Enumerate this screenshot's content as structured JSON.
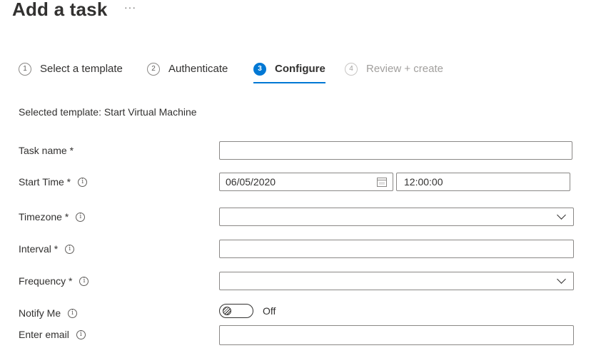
{
  "header": {
    "title": "Add a task",
    "more_label": "···"
  },
  "steps": [
    {
      "number": "1",
      "label": "Select a template",
      "state": "complete"
    },
    {
      "number": "2",
      "label": "Authenticate",
      "state": "complete"
    },
    {
      "number": "3",
      "label": "Configure",
      "state": "active"
    },
    {
      "number": "4",
      "label": "Review + create",
      "state": "disabled"
    }
  ],
  "selected_template": "Selected template: Start Virtual Machine",
  "form": {
    "task_name": {
      "label": "Task name *",
      "value": ""
    },
    "start_time": {
      "label": "Start Time *",
      "date": "06/05/2020",
      "time": "12:00:00"
    },
    "timezone": {
      "label": "Timezone *",
      "value": ""
    },
    "interval": {
      "label": "Interval *",
      "value": ""
    },
    "frequency": {
      "label": "Frequency *",
      "value": ""
    },
    "notify_me": {
      "label": "Notify Me",
      "state": "Off"
    },
    "email": {
      "label": "Enter email",
      "value": ""
    }
  },
  "icons": {
    "info": "info-icon",
    "calendar": "calendar-icon",
    "chevron": "chevron-down-icon"
  },
  "colors": {
    "accent": "#0078d4",
    "text": "#323130",
    "border": "#8a8886",
    "disabled": "#a19f9d"
  }
}
